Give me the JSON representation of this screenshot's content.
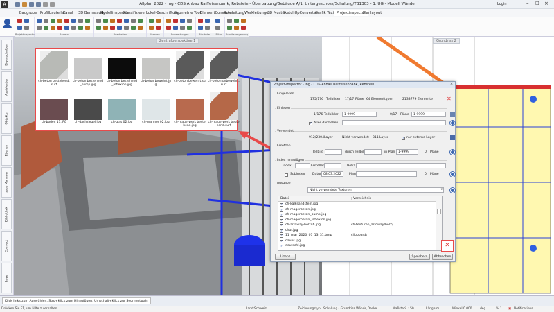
{
  "window": {
    "title": "Allplan 2022 - Ing - CDS Anbau Raiffeisenbank, Rebstein - Überbauung/Gebäude A/1. Untergeschoss/Schalung/TB1303 - 1. UG  -  Modell Wände",
    "login": "Login"
  },
  "ribbon": {
    "tabs": [
      "Baugrube",
      "Profilbauteile",
      "Kanal",
      "3D Bemassung",
      "Modellinspector",
      "Klassifizierer",
      "Lokal-Beschriftung",
      "Geometrie Tool",
      "ElementConverter",
      "Rohrleitung",
      "Werkleitungen",
      "3D Muster",
      "SketchUpConverter",
      "Grafik Text",
      "Projektinspector",
      "Planlayout"
    ],
    "active_tab": "Projektinspector",
    "groups": [
      "Projektinspector",
      "Ändern",
      "Bearbeiten",
      "Messen",
      "Auswertungen",
      "Attribute",
      "Filter",
      "Arbeitsumgebung"
    ]
  },
  "sidebar": {
    "tabs": [
      "Eigenschaften",
      "Assistenten",
      "Objekte",
      "Ebenen",
      "Issue Manager",
      "Bibliothek",
      "Connect",
      "Layer"
    ]
  },
  "viewports": {
    "left": "Zentralperspektive 1",
    "right": "Grundriss 2"
  },
  "textures": [
    {
      "name": "ch-beton bestehend.surf",
      "color": "#b8bab6",
      "kind": "cube"
    },
    {
      "name": "ch-beton bestehend_bump.jpg",
      "color": "#c9c9c9",
      "kind": "flat"
    },
    {
      "name": "ch-beton bestehend_reflexion.jpg",
      "color": "#0c0c0c",
      "kind": "flat"
    },
    {
      "name": "ch-beton bewehrt.jpg",
      "color": "#c6c6c4",
      "kind": "flat"
    },
    {
      "name": "ch-beton bewehrt.surf",
      "color": "#5a5a5a",
      "kind": "cube"
    },
    {
      "name": "ch-beton unbewehrt.surf",
      "color": "#5c5c5c",
      "kind": "cube"
    },
    {
      "name": "ch-boden 11.JPG",
      "color": "#6a4c50",
      "kind": "flat"
    },
    {
      "name": "ch-dachziegel.jpg",
      "color": "#4a4a4a",
      "kind": "flat"
    },
    {
      "name": "ch-glas 02.jpg",
      "color": "#8fb3b6",
      "kind": "flat"
    },
    {
      "name": "ch-marmor 02.jpg",
      "color": "#dfe6e8",
      "kind": "flat"
    },
    {
      "name": "ch-mauerwerk bestehend.jpg",
      "color": "#b86a4e",
      "kind": "flat"
    },
    {
      "name": "ch-mauerwerk bestehend.surf",
      "color": "#b56848",
      "kind": "cube"
    }
  ],
  "dialog": {
    "title": "Project-Inspector - Ing - CDS Anbau Raiffeisenbank, Rebstein",
    "eingelesen": {
      "label": "Eingelesen",
      "teilbilder": "175/176",
      "teilbilder_label": "Teilbilder",
      "plaene": "17/17",
      "plaene_label": "Pläne",
      "elementtypen": "64",
      "elementtypen_label": "Elementtypen",
      "elemente": "2133779",
      "elemente_label": "Elemente"
    },
    "einlesen": {
      "label": "Einlesen",
      "teilbilder": "1/176",
      "teilbilder_label": "Teilbilder",
      "teilbilder_range": "1-9999",
      "plaene": "0/17",
      "plaene_label": "Pläne",
      "plaene_range": "1-9999",
      "alles_darstellen": "Alles darstellen",
      "alles_checked": true
    },
    "verwendet": {
      "label": "Verwendet",
      "layer": "912/2304",
      "layer_label": "Layer",
      "nicht_label": "Nicht verwendet:",
      "nicht": "311",
      "nicht_layer": "Layer",
      "nur_extern": "nur externe Layer",
      "nur_extern_checked": true
    },
    "ersetzen": {
      "label": "Ersetzen",
      "teilbild": "Teilbild",
      "durch": "durch Teilbild",
      "in_plan": "in Plan",
      "plan_range": "1-9999",
      "plaene": "0",
      "plaene_label": "Pläne"
    },
    "index": {
      "label": "Index hinzufügen",
      "index": "Index",
      "ersteller": "Ersteller",
      "notiz": "Notiz",
      "subindex": "Subindex",
      "datum_label": "Datum",
      "datum": "08.03.2022",
      "plan": "Plan",
      "plaene": "0",
      "plaene_label": "Pläne"
    },
    "ausgabe": {
      "label": "Ausgabe",
      "selected": "Nicht verwendete Texturen"
    },
    "columns": [
      "Datei",
      "Verzeichnis"
    ],
    "files": [
      {
        "name": "ch-kalksandstein.jpg",
        "dir": ""
      },
      {
        "name": "ch-magerbeton.jpg",
        "dir": ""
      },
      {
        "name": "ch-magerbeton_bump.jpg",
        "dir": ""
      },
      {
        "name": "ch-magerbeton_reflexion.jpg",
        "dir": ""
      },
      {
        "name": "ch-arroway-holz46.jpg",
        "dir": "ch-texturen_arroway/holz\\"
      },
      {
        "name": "chur.jpg",
        "dir": ""
      },
      {
        "name": "11_mar_2020_07_13_31.bmp",
        "dir": "clipboard\\"
      },
      {
        "name": "davos.jpg",
        "dir": ""
      },
      {
        "name": "deutschl.jpg",
        "dir": ""
      }
    ],
    "buttons": {
      "lizenz": "Lizenz",
      "speichern": "Speichern",
      "abbrechen": "Abbrechen"
    }
  },
  "commandline": "Klick links zum Auswählen, Strg+Klick zum Hinzufügen, Umschalt+Klick zur Segmentwahl",
  "status": {
    "help": "Drücken Sie F1, um Hilfe zu erhalten.",
    "land_label": "Land:",
    "land": "Schweiz",
    "zt_label": "Zeichnungstyp:",
    "zt": "Schalung - Grundriss Wände,Decke",
    "massstab_label": "Maßstab:",
    "massstab": "1 : 50",
    "laenge_label": "Länge:",
    "laenge": "m",
    "winkel_label": "Winkel:",
    "winkel": "0.000",
    "winkel_unit": "deg",
    "pct_label": "%",
    "pct": "1",
    "notifications": "Notifications"
  },
  "colors": {
    "highlight": "#e84a4a",
    "accent": "#2b57a7"
  }
}
